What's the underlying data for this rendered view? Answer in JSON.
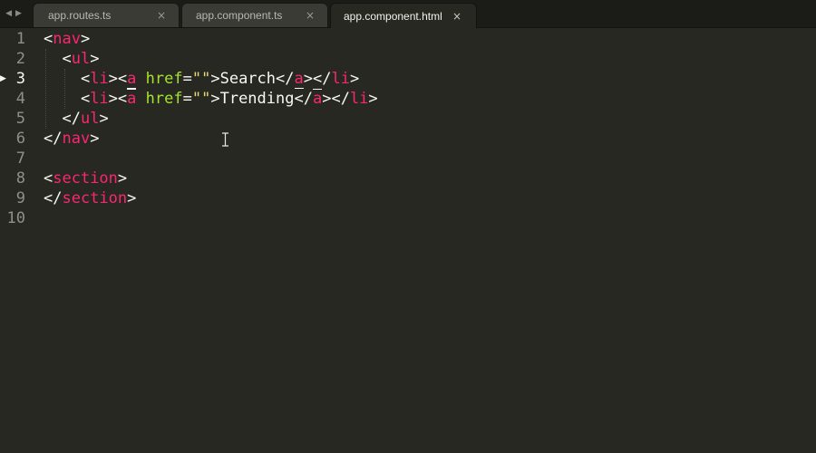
{
  "tabs": [
    {
      "label": "app.routes.ts",
      "close": "×",
      "active": false
    },
    {
      "label": "app.component.ts",
      "close": "×",
      "active": false
    },
    {
      "label": "app.component.html",
      "close": "×",
      "active": true
    }
  ],
  "nav_arrows": {
    "back": "◀",
    "forward": "▶"
  },
  "editor": {
    "current_line": 3,
    "line_numbers": [
      "1",
      "2",
      "3",
      "4",
      "5",
      "6",
      "7",
      "8",
      "9",
      "10"
    ],
    "lines": [
      [
        {
          "t": "<",
          "c": "punct"
        },
        {
          "t": "nav",
          "c": "tag"
        },
        {
          "t": ">",
          "c": "punct"
        }
      ],
      [
        {
          "t": "  <",
          "c": "punct"
        },
        {
          "t": "ul",
          "c": "tag"
        },
        {
          "t": ">",
          "c": "punct"
        }
      ],
      [
        {
          "t": "    <",
          "c": "punct"
        },
        {
          "t": "li",
          "c": "tag"
        },
        {
          "t": "><",
          "c": "punct"
        },
        {
          "t": "a",
          "c": "tag",
          "m": "u"
        },
        {
          "t": " ",
          "c": "text"
        },
        {
          "t": "href",
          "c": "attr"
        },
        {
          "t": "=",
          "c": "punct"
        },
        {
          "t": "\"\"",
          "c": "string"
        },
        {
          "t": ">",
          "c": "punct"
        },
        {
          "t": "Search",
          "c": "text"
        },
        {
          "t": "</",
          "c": "punct"
        },
        {
          "t": "a",
          "c": "tag",
          "m": "u"
        },
        {
          "t": "></",
          "c": "punct"
        },
        {
          "t": "li",
          "c": "tag"
        },
        {
          "t": ">",
          "c": "punct"
        }
      ],
      [
        {
          "t": "    <",
          "c": "punct"
        },
        {
          "t": "li",
          "c": "tag"
        },
        {
          "t": "><",
          "c": "punct"
        },
        {
          "t": "a",
          "c": "tag",
          "m": "t"
        },
        {
          "t": " ",
          "c": "text"
        },
        {
          "t": "href",
          "c": "attr"
        },
        {
          "t": "=",
          "c": "punct"
        },
        {
          "t": "\"\"",
          "c": "string"
        },
        {
          "t": ">",
          "c": "punct"
        },
        {
          "t": "Trending",
          "c": "text"
        },
        {
          "t": "</",
          "c": "punct"
        },
        {
          "t": "a",
          "c": "tag",
          "m": "t"
        },
        {
          "t": "></",
          "c": "punct"
        },
        {
          "t": "li",
          "c": "tag"
        },
        {
          "t": ">",
          "c": "punct"
        }
      ],
      [
        {
          "t": "  </",
          "c": "punct"
        },
        {
          "t": "ul",
          "c": "tag"
        },
        {
          "t": ">",
          "c": "punct"
        }
      ],
      [
        {
          "t": "</",
          "c": "punct"
        },
        {
          "t": "nav",
          "c": "tag"
        },
        {
          "t": ">",
          "c": "punct"
        }
      ],
      [],
      [
        {
          "t": "<",
          "c": "punct"
        },
        {
          "t": "section",
          "c": "tag"
        },
        {
          "t": ">",
          "c": "punct"
        }
      ],
      [
        {
          "t": "</",
          "c": "punct"
        },
        {
          "t": "section",
          "c": "tag"
        },
        {
          "t": ">",
          "c": "punct"
        }
      ],
      []
    ]
  },
  "colors": {
    "background": "#272822",
    "tag": "#f92672",
    "attribute": "#a6e22e",
    "string": "#e6db74",
    "text": "#f8f8f2"
  }
}
